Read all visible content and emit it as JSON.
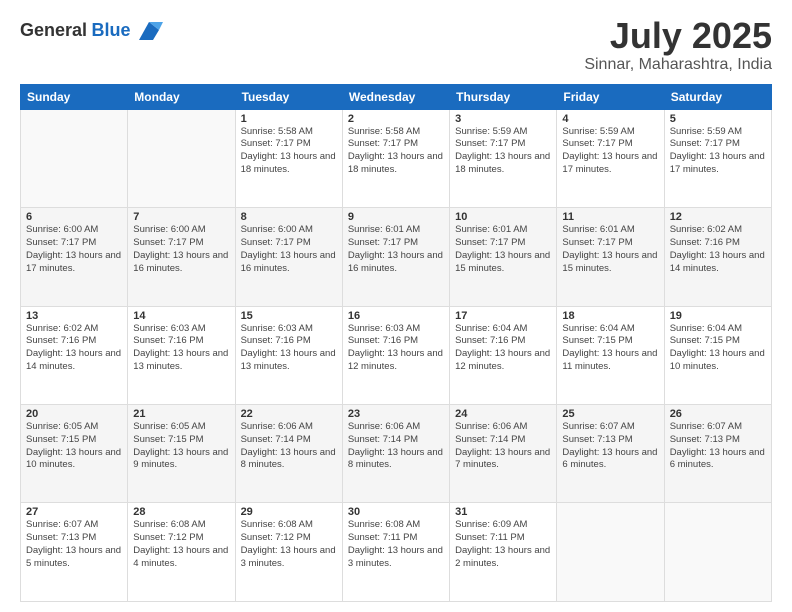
{
  "logo": {
    "general": "General",
    "blue": "Blue"
  },
  "title": "July 2025",
  "location": "Sinnar, Maharashtra, India",
  "days_of_week": [
    "Sunday",
    "Monday",
    "Tuesday",
    "Wednesday",
    "Thursday",
    "Friday",
    "Saturday"
  ],
  "weeks": [
    [
      {
        "day": "",
        "sunrise": "",
        "sunset": "",
        "daylight": ""
      },
      {
        "day": "",
        "sunrise": "",
        "sunset": "",
        "daylight": ""
      },
      {
        "day": "1",
        "sunrise": "Sunrise: 5:58 AM",
        "sunset": "Sunset: 7:17 PM",
        "daylight": "Daylight: 13 hours and 18 minutes."
      },
      {
        "day": "2",
        "sunrise": "Sunrise: 5:58 AM",
        "sunset": "Sunset: 7:17 PM",
        "daylight": "Daylight: 13 hours and 18 minutes."
      },
      {
        "day": "3",
        "sunrise": "Sunrise: 5:59 AM",
        "sunset": "Sunset: 7:17 PM",
        "daylight": "Daylight: 13 hours and 18 minutes."
      },
      {
        "day": "4",
        "sunrise": "Sunrise: 5:59 AM",
        "sunset": "Sunset: 7:17 PM",
        "daylight": "Daylight: 13 hours and 17 minutes."
      },
      {
        "day": "5",
        "sunrise": "Sunrise: 5:59 AM",
        "sunset": "Sunset: 7:17 PM",
        "daylight": "Daylight: 13 hours and 17 minutes."
      }
    ],
    [
      {
        "day": "6",
        "sunrise": "Sunrise: 6:00 AM",
        "sunset": "Sunset: 7:17 PM",
        "daylight": "Daylight: 13 hours and 17 minutes."
      },
      {
        "day": "7",
        "sunrise": "Sunrise: 6:00 AM",
        "sunset": "Sunset: 7:17 PM",
        "daylight": "Daylight: 13 hours and 16 minutes."
      },
      {
        "day": "8",
        "sunrise": "Sunrise: 6:00 AM",
        "sunset": "Sunset: 7:17 PM",
        "daylight": "Daylight: 13 hours and 16 minutes."
      },
      {
        "day": "9",
        "sunrise": "Sunrise: 6:01 AM",
        "sunset": "Sunset: 7:17 PM",
        "daylight": "Daylight: 13 hours and 16 minutes."
      },
      {
        "day": "10",
        "sunrise": "Sunrise: 6:01 AM",
        "sunset": "Sunset: 7:17 PM",
        "daylight": "Daylight: 13 hours and 15 minutes."
      },
      {
        "day": "11",
        "sunrise": "Sunrise: 6:01 AM",
        "sunset": "Sunset: 7:17 PM",
        "daylight": "Daylight: 13 hours and 15 minutes."
      },
      {
        "day": "12",
        "sunrise": "Sunrise: 6:02 AM",
        "sunset": "Sunset: 7:16 PM",
        "daylight": "Daylight: 13 hours and 14 minutes."
      }
    ],
    [
      {
        "day": "13",
        "sunrise": "Sunrise: 6:02 AM",
        "sunset": "Sunset: 7:16 PM",
        "daylight": "Daylight: 13 hours and 14 minutes."
      },
      {
        "day": "14",
        "sunrise": "Sunrise: 6:03 AM",
        "sunset": "Sunset: 7:16 PM",
        "daylight": "Daylight: 13 hours and 13 minutes."
      },
      {
        "day": "15",
        "sunrise": "Sunrise: 6:03 AM",
        "sunset": "Sunset: 7:16 PM",
        "daylight": "Daylight: 13 hours and 13 minutes."
      },
      {
        "day": "16",
        "sunrise": "Sunrise: 6:03 AM",
        "sunset": "Sunset: 7:16 PM",
        "daylight": "Daylight: 13 hours and 12 minutes."
      },
      {
        "day": "17",
        "sunrise": "Sunrise: 6:04 AM",
        "sunset": "Sunset: 7:16 PM",
        "daylight": "Daylight: 13 hours and 12 minutes."
      },
      {
        "day": "18",
        "sunrise": "Sunrise: 6:04 AM",
        "sunset": "Sunset: 7:15 PM",
        "daylight": "Daylight: 13 hours and 11 minutes."
      },
      {
        "day": "19",
        "sunrise": "Sunrise: 6:04 AM",
        "sunset": "Sunset: 7:15 PM",
        "daylight": "Daylight: 13 hours and 10 minutes."
      }
    ],
    [
      {
        "day": "20",
        "sunrise": "Sunrise: 6:05 AM",
        "sunset": "Sunset: 7:15 PM",
        "daylight": "Daylight: 13 hours and 10 minutes."
      },
      {
        "day": "21",
        "sunrise": "Sunrise: 6:05 AM",
        "sunset": "Sunset: 7:15 PM",
        "daylight": "Daylight: 13 hours and 9 minutes."
      },
      {
        "day": "22",
        "sunrise": "Sunrise: 6:06 AM",
        "sunset": "Sunset: 7:14 PM",
        "daylight": "Daylight: 13 hours and 8 minutes."
      },
      {
        "day": "23",
        "sunrise": "Sunrise: 6:06 AM",
        "sunset": "Sunset: 7:14 PM",
        "daylight": "Daylight: 13 hours and 8 minutes."
      },
      {
        "day": "24",
        "sunrise": "Sunrise: 6:06 AM",
        "sunset": "Sunset: 7:14 PM",
        "daylight": "Daylight: 13 hours and 7 minutes."
      },
      {
        "day": "25",
        "sunrise": "Sunrise: 6:07 AM",
        "sunset": "Sunset: 7:13 PM",
        "daylight": "Daylight: 13 hours and 6 minutes."
      },
      {
        "day": "26",
        "sunrise": "Sunrise: 6:07 AM",
        "sunset": "Sunset: 7:13 PM",
        "daylight": "Daylight: 13 hours and 6 minutes."
      }
    ],
    [
      {
        "day": "27",
        "sunrise": "Sunrise: 6:07 AM",
        "sunset": "Sunset: 7:13 PM",
        "daylight": "Daylight: 13 hours and 5 minutes."
      },
      {
        "day": "28",
        "sunrise": "Sunrise: 6:08 AM",
        "sunset": "Sunset: 7:12 PM",
        "daylight": "Daylight: 13 hours and 4 minutes."
      },
      {
        "day": "29",
        "sunrise": "Sunrise: 6:08 AM",
        "sunset": "Sunset: 7:12 PM",
        "daylight": "Daylight: 13 hours and 3 minutes."
      },
      {
        "day": "30",
        "sunrise": "Sunrise: 6:08 AM",
        "sunset": "Sunset: 7:11 PM",
        "daylight": "Daylight: 13 hours and 3 minutes."
      },
      {
        "day": "31",
        "sunrise": "Sunrise: 6:09 AM",
        "sunset": "Sunset: 7:11 PM",
        "daylight": "Daylight: 13 hours and 2 minutes."
      },
      {
        "day": "",
        "sunrise": "",
        "sunset": "",
        "daylight": ""
      },
      {
        "day": "",
        "sunrise": "",
        "sunset": "",
        "daylight": ""
      }
    ]
  ]
}
